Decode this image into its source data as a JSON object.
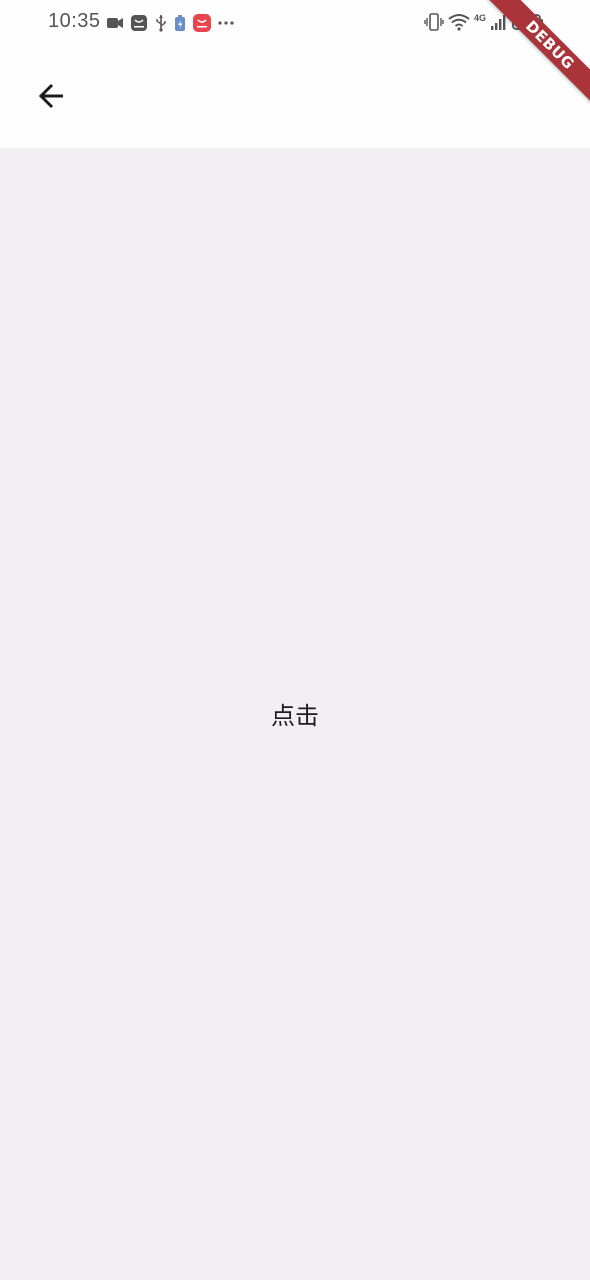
{
  "status_bar": {
    "time": "10:35",
    "left_icons": [
      "video-camera-icon",
      "app-store-icon",
      "usb-icon",
      "battery-saver-icon",
      "shopping-app-icon",
      "more-dots-icon"
    ],
    "right_icons": [
      "vibrate-icon",
      "wifi-icon",
      "4g-icon",
      "signal-icon",
      "battery-icon"
    ],
    "network_label": "4G"
  },
  "app_bar": {
    "back_icon": "arrow-back-icon"
  },
  "body": {
    "center_text": "点击"
  },
  "debug_banner": {
    "label": "DEBUG"
  },
  "colors": {
    "background": "#f2eff3",
    "app_bar": "#fefefe",
    "text": "#1c1b1f",
    "debug_ribbon": "#a9353a"
  }
}
